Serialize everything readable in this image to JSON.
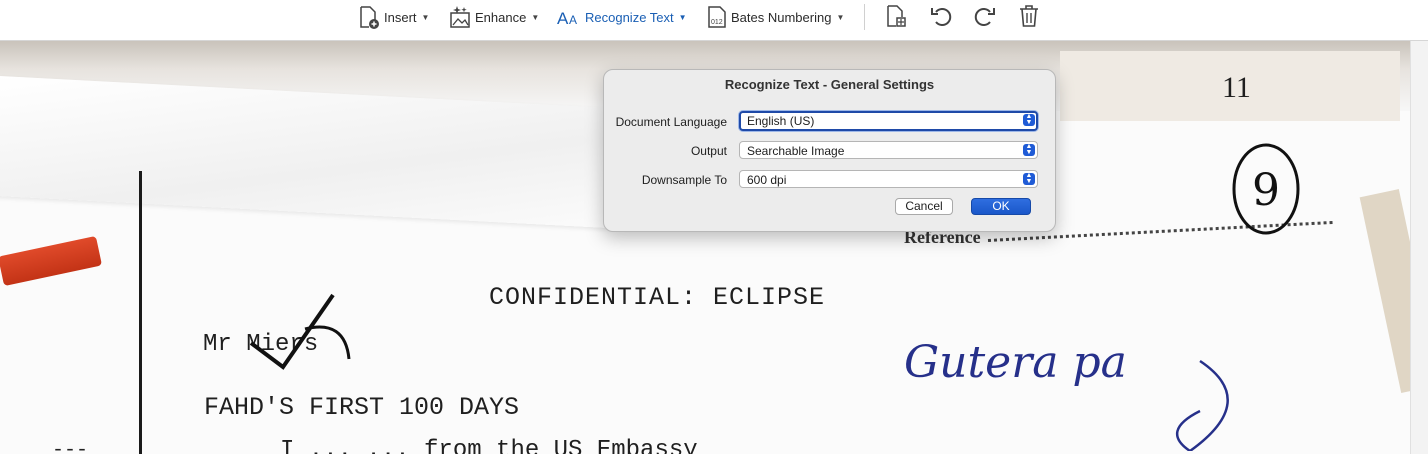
{
  "toolbar": {
    "insert_label": "Insert",
    "enhance_label": "Enhance",
    "recognize_label": "Recognize Text",
    "bates_label": "Bates Numbering",
    "bates_icon_text": "012",
    "icons": [
      "insert-page-icon",
      "enhance-icon",
      "recognize-text-icon",
      "bates-numbering-icon",
      "extract-page-icon",
      "rotate-left-icon",
      "rotate-right-icon",
      "trash-icon"
    ],
    "accent_color": "#1a5fb4"
  },
  "document": {
    "reference_label": "Reference",
    "annotation_number": "9",
    "header_mark": "11",
    "heading": "CONFIDENTIAL:  ECLIPSE",
    "recipient": "Mr Miers",
    "title": "FAHD'S FIRST 100 DAYS",
    "body_line": "I  ...                     ...   from the US Embassy",
    "handwriting": "Gutera pa"
  },
  "dialog": {
    "title": "Recognize Text - General Settings",
    "language_label": "Document Language",
    "language_value": "English (US)",
    "output_label": "Output",
    "output_value": "Searchable Image",
    "downsample_label": "Downsample To",
    "downsample_value": "600 dpi",
    "cancel_label": "Cancel",
    "ok_label": "OK",
    "ok_color": "#1a57c9"
  }
}
